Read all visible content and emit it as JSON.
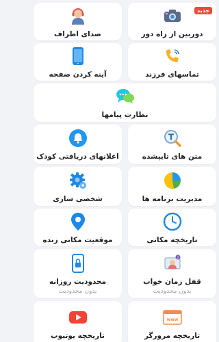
{
  "cards": {
    "remote_camera": {
      "label": "دوربین از راه دور",
      "badge": "جدید",
      "icon": "camera-icon"
    },
    "ambient_sound": {
      "label": "صدای اطراف",
      "icon": "headset-person-icon"
    },
    "child_calls": {
      "label": "تماسهای فرزند",
      "icon": "phone-call-icon"
    },
    "screen_mirror": {
      "label": "آینه کردن صفحه",
      "icon": "smartphone-icon"
    },
    "message_monitor": {
      "label": "نظارت پیامها",
      "icon": "chat-bubbles-icon"
    },
    "typed_texts": {
      "label": "متن های تایپشده",
      "icon": "text-magnifier-icon"
    },
    "child_notifications": {
      "label": "اعلانهای دریافتی کودک",
      "icon": "bell-icon"
    },
    "app_management": {
      "label": "مدیریت برنامه ها",
      "icon": "pie-chart-icon"
    },
    "customization": {
      "label": "شخصی سازی",
      "icon": "gear-icon"
    },
    "location_history": {
      "label": "تاریخچه مکانی",
      "icon": "clock-icon"
    },
    "live_location": {
      "label": "موقعیت مکانی زنده",
      "icon": "location-pin-icon"
    },
    "sleep_lock": {
      "label": "قفل زمان خواب",
      "sub": "بدون محدودیت",
      "icon": "sleep-person-icon"
    },
    "daily_limit": {
      "label": "محدودیت روزانه",
      "sub": "بدون محدودیت",
      "icon": "phone-lock-icon"
    },
    "browser_history": {
      "label": "تاریخچه مرورگر",
      "icon": "browser-www-icon"
    },
    "youtube_history": {
      "label": "تاریخچه یوتیوب",
      "icon": "youtube-icon"
    }
  },
  "colors": {
    "background": "#f2f3f7",
    "card": "#ffffff",
    "badge": "#e84c3d",
    "blue": "#2196f3",
    "teal": "#26c6da",
    "yellow": "#ffc107",
    "red": "#f44336",
    "green": "#4caf50"
  }
}
